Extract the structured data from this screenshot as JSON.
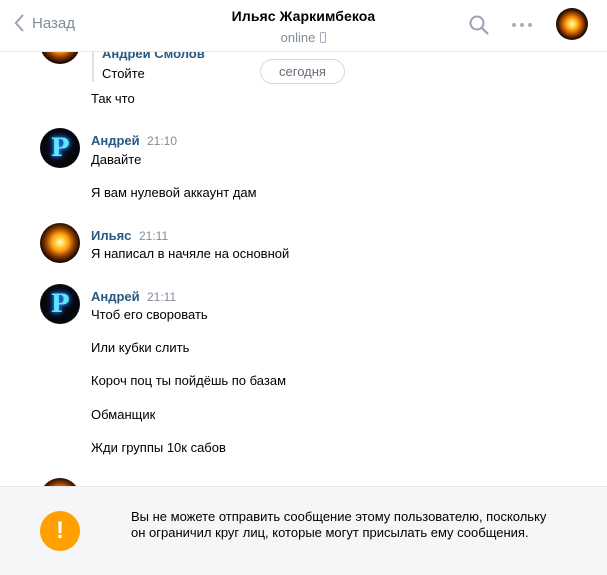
{
  "header": {
    "back_label": "Назад",
    "title": "Ильяс Жаркимбекоа",
    "status": "online"
  },
  "chat": {
    "quote": {
      "author": "Андрей Смолов",
      "text": "Стойте"
    },
    "date_separator": "сегодня",
    "pre_messages": [
      "Так что"
    ],
    "groups": [
      {
        "author": "Андрей",
        "time": "21:10",
        "avatar": "p-logo",
        "messages": [
          "Давайте",
          "Я вам нулевой аккаунт дам"
        ]
      },
      {
        "author": "Ильяс",
        "time": "21:11",
        "avatar": "glowing-orb",
        "messages": [
          "Я написал в начяле на основной"
        ]
      },
      {
        "author": "Андрей",
        "time": "21:11",
        "avatar": "p-logo",
        "messages": [
          "Чтоб его своровать",
          "Или кубки слить",
          "Короч поц ты пойдёшь по базам",
          "Обманщик",
          "Жди группы 10к сабов"
        ]
      }
    ]
  },
  "footer": {
    "icon": "exclamation-icon",
    "notice": "Вы не можете отправить сообщение этому пользователю, поскольку он ограничил круг лиц, которые могут присылать ему сообщения."
  },
  "colors": {
    "link": "#2a5885",
    "muted": "#818c99",
    "warning": "#ffa000",
    "footer_bg": "#f5f6f8"
  }
}
